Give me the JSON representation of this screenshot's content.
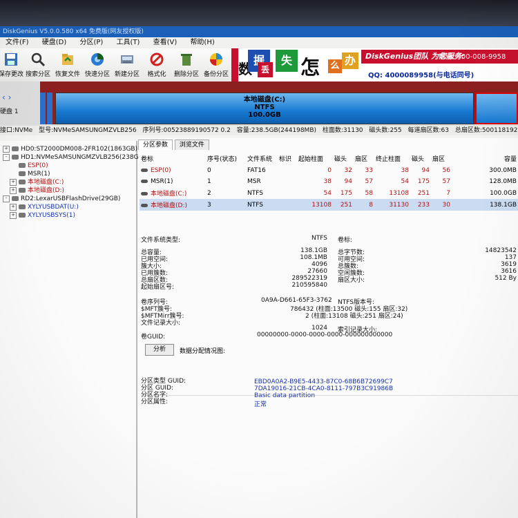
{
  "window": {
    "title": "DiskGenius V5.0.0.580 x64 免费版(网友授权版)"
  },
  "menu": [
    "文件(F)",
    "硬盘(D)",
    "分区(P)",
    "工具(T)",
    "查看(V)",
    "帮助(H)"
  ],
  "toolbar": [
    {
      "label": "保存更改",
      "icon": "save-icon"
    },
    {
      "label": "搜索分区",
      "icon": "search-icon"
    },
    {
      "label": "恢复文件",
      "icon": "recover-icon"
    },
    {
      "label": "快速分区",
      "icon": "quick-partition-icon"
    },
    {
      "label": "新建分区",
      "icon": "new-partition-icon"
    },
    {
      "label": "格式化",
      "icon": "format-icon"
    },
    {
      "label": "删除分区",
      "icon": "delete-icon"
    },
    {
      "label": "备份分区",
      "icon": "backup-icon"
    }
  ],
  "banner": {
    "tiles": [
      "数",
      "据",
      "丢",
      "失",
      "怎",
      "么",
      "办"
    ],
    "team": "DiskGenius团队 为您服务:",
    "phone": "电话: 400-008-9958",
    "qq": "QQ: 4000089958(与电话同号)"
  },
  "diskmap": {
    "disk_label": "硬盘 1",
    "partition_name": "本地磁盘(C:)",
    "partition_fs": "NTFS",
    "partition_size": "100.0GB"
  },
  "diskinfo": {
    "interface": "接口:NVMe",
    "model": "型号:NVMeSAMSUNGMZVLB256",
    "serial": "序列号:00523889190572 0.2",
    "capacity": "容量:238.5GB(244198MB)",
    "cylinders": "柱面数:31130",
    "heads": "磁头数:255",
    "sectors_per_track": "每道扇区数:63",
    "total_sectors": "总扇区数:500118192"
  },
  "tree": [
    {
      "label": "HD0:ST2000DM008-2FR102(1863GB)",
      "indent": 0,
      "color": "#111111",
      "exp": "+"
    },
    {
      "label": "HD1:NVMeSAMSUNGMZVLB256(238GB)",
      "indent": 0,
      "color": "#111111",
      "exp": "-"
    },
    {
      "label": "ESP(0)",
      "indent": 1,
      "color": "#b01010",
      "exp": ""
    },
    {
      "label": "MSR(1)",
      "indent": 1,
      "color": "#111111",
      "exp": ""
    },
    {
      "label": "本地磁盘(C:)",
      "indent": 1,
      "color": "#b01010",
      "exp": "+"
    },
    {
      "label": "本地磁盘(D:)",
      "indent": 1,
      "color": "#b01010",
      "exp": "+"
    },
    {
      "label": "RD2:LexarUSBFlashDrive(29GB)",
      "indent": 0,
      "color": "#111111",
      "exp": "-"
    },
    {
      "label": "XYLYUSBDAT(U:)",
      "indent": 1,
      "color": "#1530a8",
      "exp": "+"
    },
    {
      "label": "XYLYUSBSYS(1)",
      "indent": 1,
      "color": "#1530a8",
      "exp": "+"
    }
  ],
  "tabs": [
    "分区参数",
    "浏览文件"
  ],
  "table": {
    "headers": [
      "卷标",
      "序号(状态)",
      "文件系统",
      "标识",
      "起始柱面",
      "磁头",
      "扇区",
      "终止柱面",
      "磁头",
      "扇区",
      "容量"
    ],
    "rows": [
      [
        "ESP(0)",
        "0",
        "FAT16",
        "",
        "0",
        "32",
        "33",
        "38",
        "94",
        "56",
        "300.0MB"
      ],
      [
        "MSR(1)",
        "1",
        "MSR",
        "",
        "38",
        "94",
        "57",
        "54",
        "175",
        "57",
        "128.0MB"
      ],
      [
        "本地磁盘(C:)",
        "2",
        "NTFS",
        "",
        "54",
        "175",
        "58",
        "13108",
        "251",
        "7",
        "100.0GB"
      ],
      [
        "本地磁盘(D:)",
        "3",
        "NTFS",
        "",
        "13108",
        "251",
        "8",
        "31130",
        "233",
        "30",
        "138.1GB"
      ]
    ]
  },
  "fs": {
    "type_label": "文件系统类型:",
    "type_value": "NTFS",
    "vol_label": "卷标:",
    "total_label": "总容量:",
    "total_value": "138.1GB",
    "used_label": "已用空间:",
    "used_value": "108.1MB",
    "cluster_label": "簇大小:",
    "cluster_value": "4096",
    "used_clusters_label": "已用簇数:",
    "used_clusters_value": "27660",
    "total_sectors_label": "总扇区数:",
    "total_sectors_value": "289522319",
    "start_sector_label": "起始扇区号:",
    "start_sector_value": "210595840",
    "total_bytes_label": "总字节数:",
    "total_bytes_value": "14823542",
    "free_label": "可用空间:",
    "free_value": "137",
    "total_clusters_label": "总簇数:",
    "total_clusters_value": "3619",
    "free_clusters_label": "空闲簇数:",
    "free_clusters_value": "3616",
    "sector_size_label": "扇区大小:",
    "sector_size_value": "512 By",
    "serial_label": "卷序列号:",
    "serial_value": "0A9A-D661-65F3-3762",
    "ntfs_ver_label": "NTFS版本号:",
    "mft_label": "$MFT簇号:",
    "mft_value": "786432 (柱面:13500 磁头:155 扇区:32)",
    "mftmirr_label": "$MFTMirr簇号:",
    "mftmirr_value": "2 (柱面:13108 磁头:251 扇区:24)",
    "record_label": "文件记录大小:",
    "record_value": "1024",
    "index_label": "索引记录大小:",
    "guid_label": "卷GUID:",
    "guid_value": "00000000-0000-0000-0000-000000000000"
  },
  "analyze": {
    "button": "分析",
    "map_label": "数据分配情况图:"
  },
  "part": {
    "type_guid_label": "分区类型 GUID:",
    "type_guid_value": "EBD0A0A2-B9E5-4433-87C0-68B6B72699C7",
    "guid_label": "分区 GUID:",
    "guid_value": "7DA19016-21CB-4CA0-8111-797B3C91986B",
    "name_label": "分区名字:",
    "name_value": "Basic data partition",
    "attr_label": "分区属性:",
    "attr_value": "正常"
  }
}
